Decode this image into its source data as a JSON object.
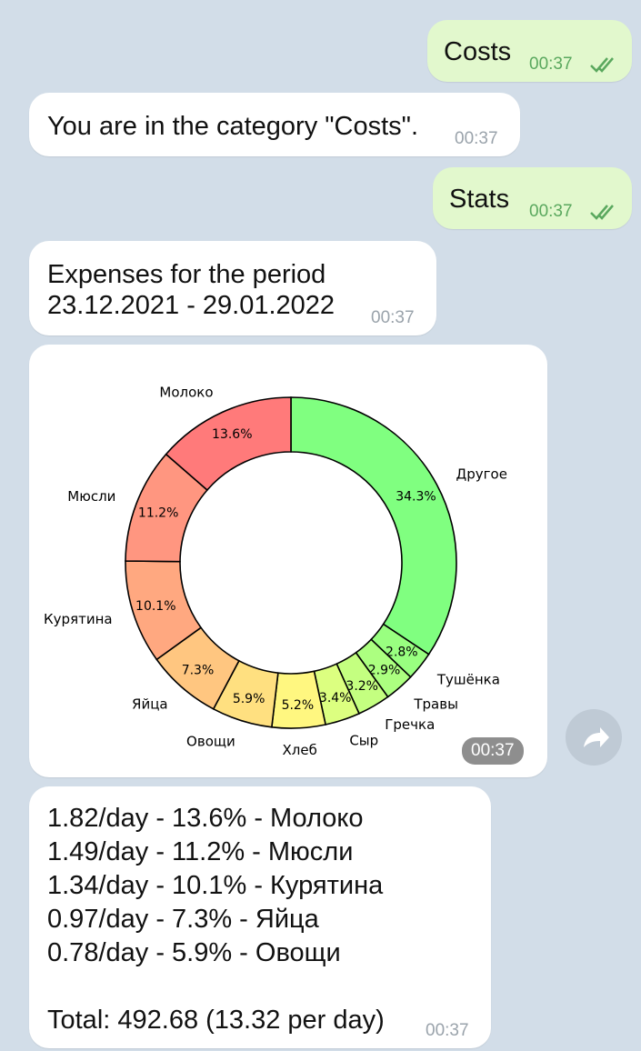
{
  "messages": {
    "costs": {
      "text": "Costs",
      "time": "00:37"
    },
    "category": {
      "text": "You are in the category \"Costs\".",
      "time": "00:37"
    },
    "stats": {
      "text": "Stats",
      "time": "00:37"
    },
    "period": {
      "line1": "Expenses for the period",
      "line2": "23.12.2021 - 29.01.2022",
      "time": "00:37"
    },
    "chart": {
      "time": "00:37"
    },
    "summary": {
      "lines": [
        "1.82/day - 13.6% - Молоко",
        "1.49/day - 11.2% - Мюсли",
        "1.34/day - 10.1% - Курятина",
        "0.97/day - 7.3% - Яйца",
        "0.78/day - 5.9% - Овощи"
      ],
      "total": "Total: 492.68 (13.32 per day)",
      "time": "00:37"
    }
  },
  "colors": {
    "background": "#d2dde8",
    "outgoing_bubble": "#e2f8cd",
    "incoming_bubble": "#ffffff",
    "check_green": "#5aa85e"
  },
  "icons": {
    "read_receipt": "double-check-icon",
    "forward": "forward-arrow-icon"
  },
  "chart_data": {
    "type": "pie",
    "donut": true,
    "start": "top",
    "direction": "clockwise",
    "slices": [
      {
        "label": "Другое",
        "percent_label": "34.3%",
        "value": 34.3,
        "color": "#80ff80"
      },
      {
        "label": "Тушёнка",
        "percent_label": "2.8%",
        "value": 2.8,
        "color": "#99ff80"
      },
      {
        "label": "Травы",
        "percent_label": "2.9%",
        "value": 2.9,
        "color": "#acff80"
      },
      {
        "label": "Гречка",
        "percent_label": "3.2%",
        "value": 3.2,
        "color": "#c4ff80"
      },
      {
        "label": "Сыр",
        "percent_label": "3.4%",
        "value": 3.4,
        "color": "#dcff80"
      },
      {
        "label": "Хлеб",
        "percent_label": "5.2%",
        "value": 5.2,
        "color": "#fff780"
      },
      {
        "label": "Овощи",
        "percent_label": "5.9%",
        "value": 5.9,
        "color": "#ffe080"
      },
      {
        "label": "Яйца",
        "percent_label": "7.3%",
        "value": 7.3,
        "color": "#ffc680"
      },
      {
        "label": "Курятина",
        "percent_label": "10.1%",
        "value": 10.1,
        "color": "#ffa880"
      },
      {
        "label": "Мюсли",
        "percent_label": "11.2%",
        "value": 11.2,
        "color": "#ff9680"
      },
      {
        "label": "Молоко",
        "percent_label": "13.6%",
        "value": 13.6,
        "color": "#ff7a7a"
      }
    ]
  }
}
